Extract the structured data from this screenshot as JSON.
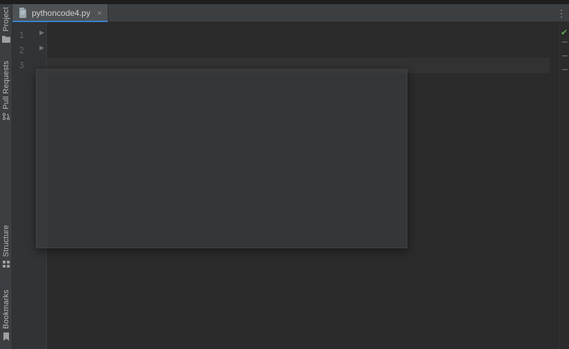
{
  "leftRail": {
    "items": [
      {
        "label": "Project",
        "iconName": "folder-icon"
      },
      {
        "label": "Pull Requests",
        "iconName": "git-pull-request-icon"
      },
      {
        "label": "Structure",
        "iconName": "structure-icon"
      },
      {
        "label": "Bookmarks",
        "iconName": "bookmark-icon"
      }
    ]
  },
  "tabs": {
    "items": [
      {
        "filename": "pythoncode4.py",
        "active": true
      }
    ],
    "moreGlyph": "⋮",
    "closeGlyph": "×"
  },
  "editor": {
    "lineNumbers": [
      "1",
      "2",
      "3"
    ],
    "currentLineIndex": 2,
    "foldMarkers": [
      {
        "line": 0,
        "glyph": "▶"
      },
      {
        "line": 1,
        "glyph": "▶"
      }
    ],
    "analysisStatus": {
      "ok": true,
      "glyph": "✔"
    },
    "markerTicks": [
      {
        "topPx": 28
      },
      {
        "topPx": 48
      },
      {
        "topPx": 68
      }
    ]
  },
  "popup": {
    "visible": true,
    "leftPx": 52,
    "topPx": 100,
    "widthPx": 538,
    "heightPx": 260
  }
}
